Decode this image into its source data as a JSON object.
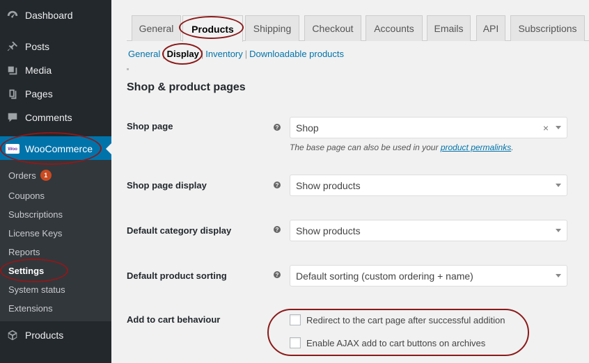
{
  "sidebar": {
    "menu": [
      {
        "label": "Dashboard",
        "icon": "dashboard-icon"
      },
      {
        "label": "Posts",
        "icon": "pin-icon"
      },
      {
        "label": "Media",
        "icon": "media-icon"
      },
      {
        "label": "Pages",
        "icon": "pages-icon"
      },
      {
        "label": "Comments",
        "icon": "comments-icon"
      },
      {
        "label": "WooCommerce",
        "icon": "woocommerce-icon",
        "logo_text": "Woo"
      },
      {
        "label": "Products",
        "icon": "products-icon"
      }
    ],
    "submenu": [
      {
        "label": "Orders",
        "badge": "1"
      },
      {
        "label": "Coupons"
      },
      {
        "label": "Subscriptions"
      },
      {
        "label": "License Keys"
      },
      {
        "label": "Reports"
      },
      {
        "label": "Settings"
      },
      {
        "label": "System status"
      },
      {
        "label": "Extensions"
      }
    ]
  },
  "tabs": [
    "General",
    "Products",
    "Shipping",
    "Checkout",
    "Accounts",
    "Emails",
    "API",
    "Subscriptions"
  ],
  "active_tab": "Products",
  "subnav": [
    "General",
    "Display",
    "Inventory",
    "Downloadable products"
  ],
  "active_subnav": "Display",
  "section_title": "Shop & product pages",
  "settings": {
    "shop_page": {
      "label": "Shop page",
      "value": "Shop",
      "clear": "×",
      "desc_prefix": "The base page can also be used in your ",
      "desc_link": "product permalinks",
      "desc_suffix": "."
    },
    "shop_page_display": {
      "label": "Shop page display",
      "value": "Show products"
    },
    "default_category_display": {
      "label": "Default category display",
      "value": "Show products"
    },
    "default_product_sorting": {
      "label": "Default product sorting",
      "value": "Default sorting (custom ordering + name)"
    },
    "add_to_cart": {
      "label": "Add to cart behaviour",
      "options": [
        {
          "label": "Redirect to the cart page after successful addition",
          "checked": false
        },
        {
          "label": "Enable AJAX add to cart buttons on archives",
          "checked": false
        }
      ]
    }
  },
  "help_glyph": "?",
  "colors": {
    "sidebar_bg": "#23282d",
    "submenu_bg": "#32373c",
    "accent": "#0073aa",
    "annotation": "#8b1a1a",
    "badge": "#ca4a1f"
  }
}
